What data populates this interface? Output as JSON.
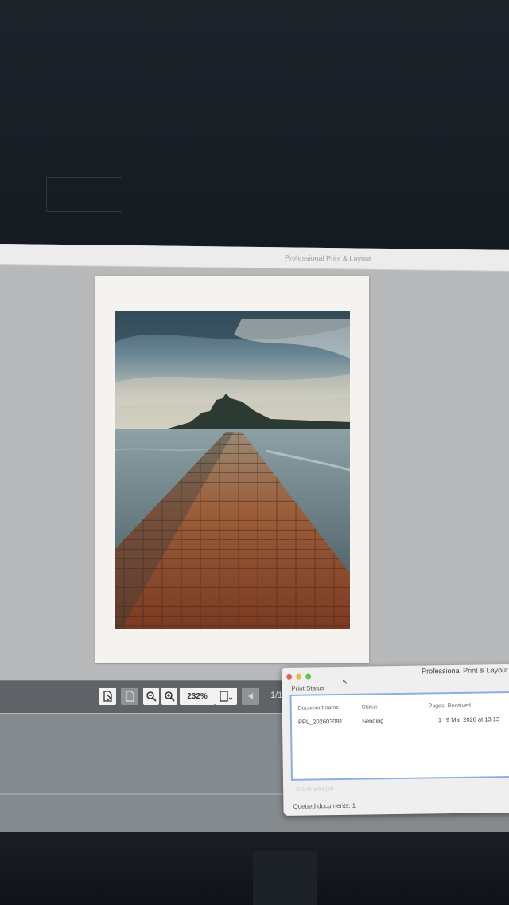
{
  "window": {
    "title": "Professional Print & Layout"
  },
  "toolbar": {
    "zoom_value": "232%",
    "page_indicator": "1/1"
  },
  "print_status": {
    "title": "Professional Print & Layout",
    "subtitle": "Print Status",
    "columns": {
      "document": "Document name",
      "status": "Status",
      "pages": "Pages",
      "received": "Received"
    },
    "rows": [
      {
        "document": "PPL_202603091...",
        "status": "Sending",
        "pages": "1",
        "received": "9 Mar 2026 at 13:13"
      }
    ],
    "buttons": {
      "delete": "Delete print job"
    },
    "queue_label": "Queued documents: 1"
  },
  "icons": {
    "export": "export-icon",
    "import": "import-icon",
    "zoom_out": "zoom-out-icon",
    "zoom_in": "zoom-in-icon",
    "page_setup": "page-setup-icon",
    "prev": "previous-page-icon"
  }
}
